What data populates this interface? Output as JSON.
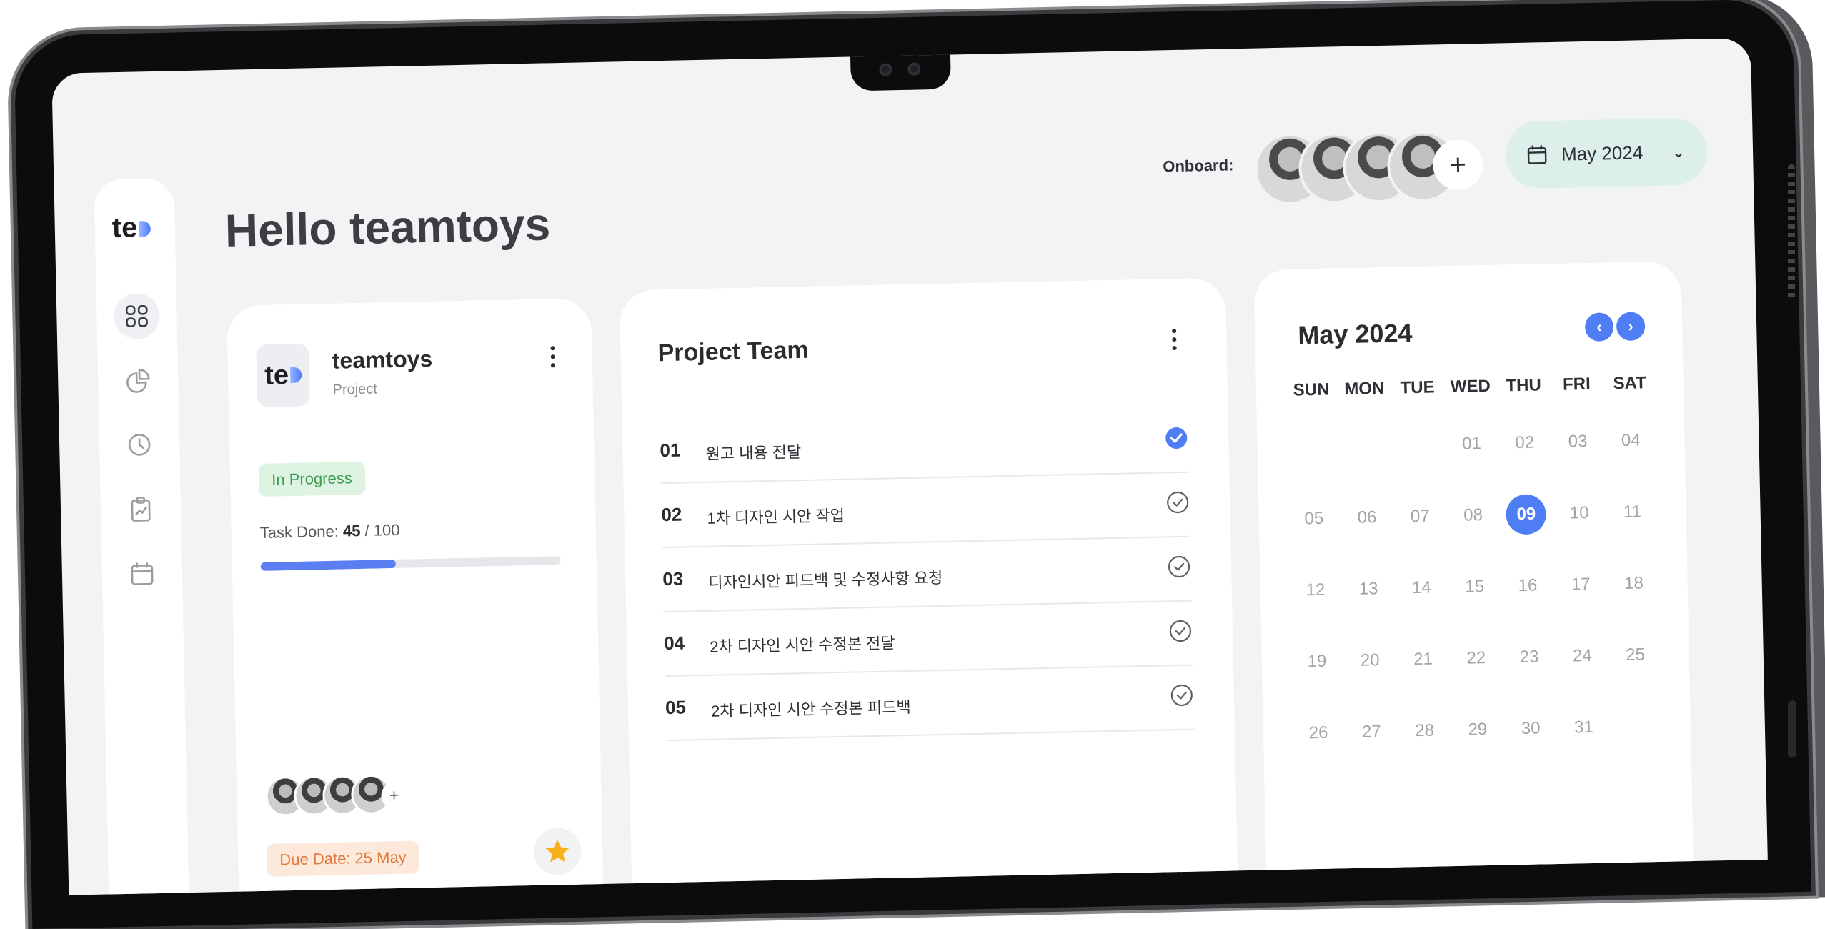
{
  "greeting": "Hello teamtoys",
  "logo_text": "te",
  "header": {
    "onboard_label": "Onboard:",
    "add_label": "+",
    "date_label": "May 2024",
    "chevron": "⌄"
  },
  "sidebar": {
    "items": [
      {
        "name": "dashboard-icon",
        "active": true
      },
      {
        "name": "pie-chart-icon",
        "active": false
      },
      {
        "name": "clock-icon",
        "active": false
      },
      {
        "name": "clipboard-chart-icon",
        "active": false
      },
      {
        "name": "calendar-icon",
        "active": false
      }
    ]
  },
  "project_card": {
    "logo_text": "te",
    "name": "teamtoys",
    "type": "Project",
    "status": "In Progress",
    "task_prefix": "Task Done: ",
    "task_done": "45",
    "task_total": " / 100",
    "progress_fraction": 0.45,
    "add_member": "+",
    "due_date": "Due Date: 25 May"
  },
  "project_team": {
    "title": "Project Team",
    "tasks": [
      {
        "num": "01",
        "text": "원고 내용 전달",
        "done": true
      },
      {
        "num": "02",
        "text": "1차 디자인 시안 작업",
        "done": false
      },
      {
        "num": "03",
        "text": "디자인시안 피드백 및 수정사항 요청",
        "done": false
      },
      {
        "num": "04",
        "text": "2차 디자인 시안 수정본 전달",
        "done": false
      },
      {
        "num": "05",
        "text": "2차 디자인 시안 수정본 피드백",
        "done": false
      }
    ]
  },
  "calendar": {
    "title": "May 2024",
    "prev": "‹",
    "next": "›",
    "weekdays": [
      "SUN",
      "MON",
      "TUE",
      "WED",
      "THU",
      "FRI",
      "SAT"
    ],
    "weeks": [
      [
        "",
        "",
        "",
        "01",
        "02",
        "03",
        "04"
      ],
      [
        "05",
        "06",
        "07",
        "08",
        "09",
        "10",
        "11"
      ],
      [
        "12",
        "13",
        "14",
        "15",
        "16",
        "17",
        "18"
      ],
      [
        "19",
        "20",
        "21",
        "22",
        "23",
        "24",
        "25"
      ],
      [
        "26",
        "27",
        "28",
        "29",
        "30",
        "31",
        ""
      ]
    ],
    "selected": "09"
  },
  "colors": {
    "accent": "#4f7df3",
    "progress": "#5b7ef2",
    "status_green": "#3f9e55",
    "due_orange": "#e0783a",
    "star": "#f6b21b",
    "date_pill": "#dcefeb"
  }
}
